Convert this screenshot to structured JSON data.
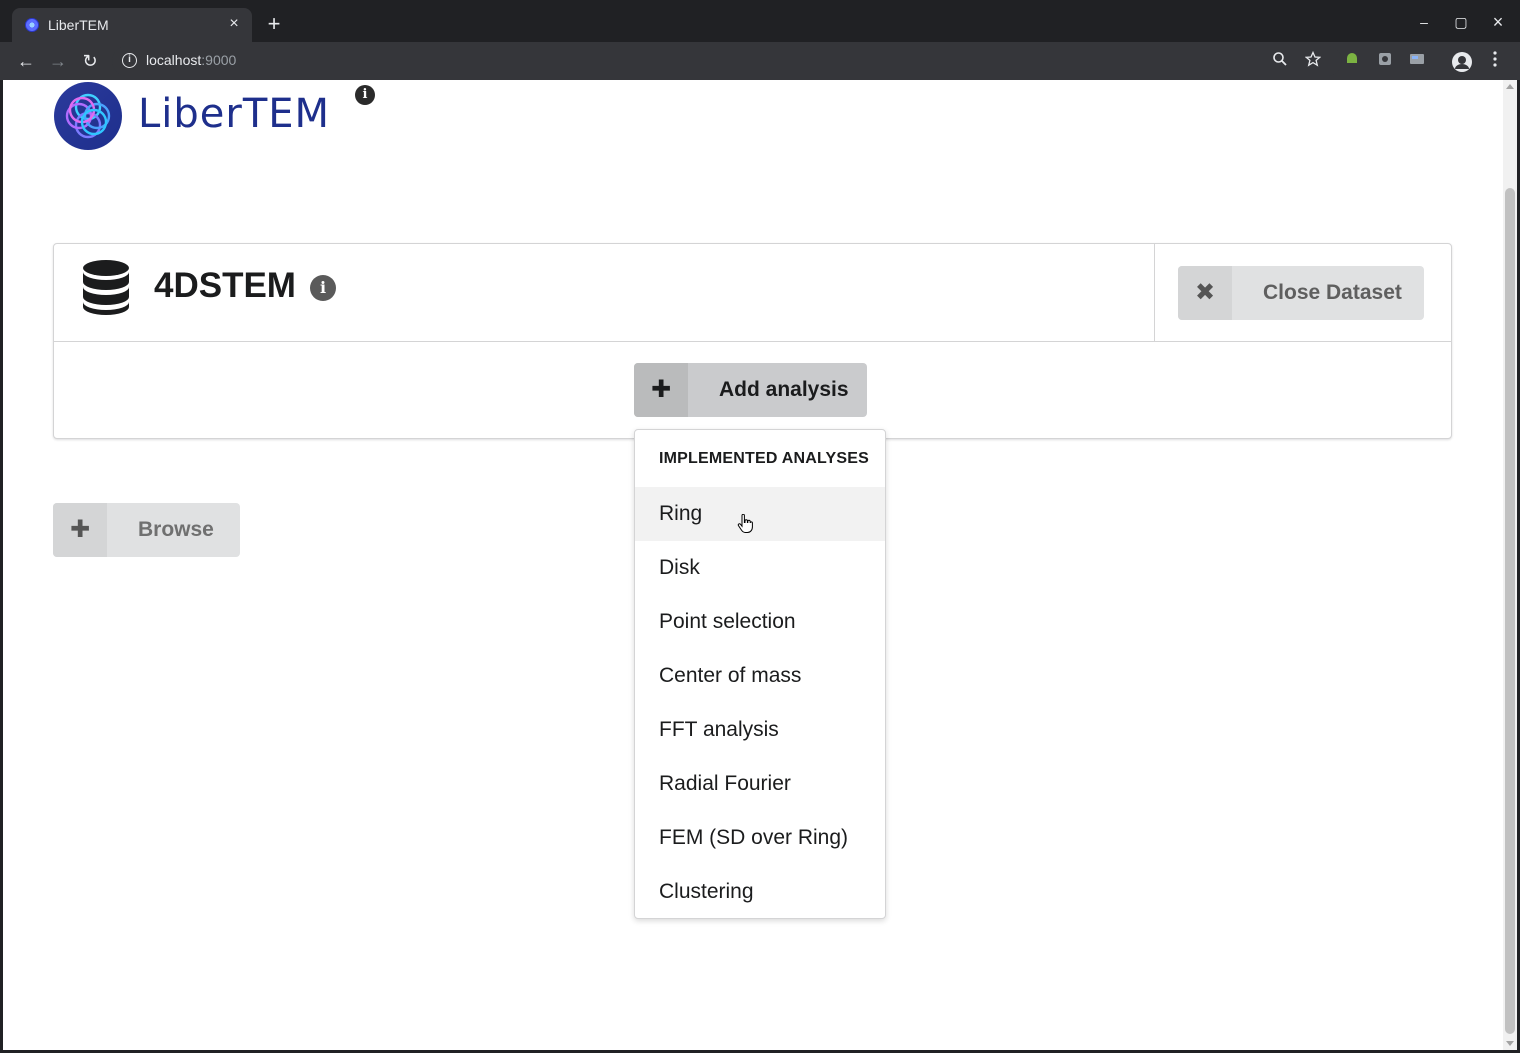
{
  "browser": {
    "tab_title": "LiberTEM",
    "tab_close": "×",
    "new_tab": "+",
    "url_host": "localhost",
    "url_port": ":9000",
    "window_controls": [
      "–",
      "▢",
      "×"
    ],
    "nav": {
      "back": "←",
      "forward": "→",
      "reload": "↻"
    }
  },
  "app": {
    "logo_text": "LiberTEM",
    "about_icon": "i"
  },
  "dataset": {
    "title": "4DSTEM",
    "info_icon": "i",
    "close_button": "Close Dataset",
    "close_icon": "✖",
    "add_analysis_button": "Add analysis",
    "add_icon": "✚"
  },
  "dropdown": {
    "header": "IMPLEMENTED ANALYSES",
    "items": [
      "Ring",
      "Disk",
      "Point selection",
      "Center of mass",
      "FFT analysis",
      "Radial Fourier",
      "FEM (SD over Ring)",
      "Clustering"
    ],
    "hovered_item": "Ring"
  },
  "browse": {
    "label": "Browse",
    "icon": "✚"
  },
  "colors": {
    "logo_text": "#1e2f8c",
    "button_bg": "#e0e1e2",
    "active_button_bg": "#cacbcd"
  }
}
